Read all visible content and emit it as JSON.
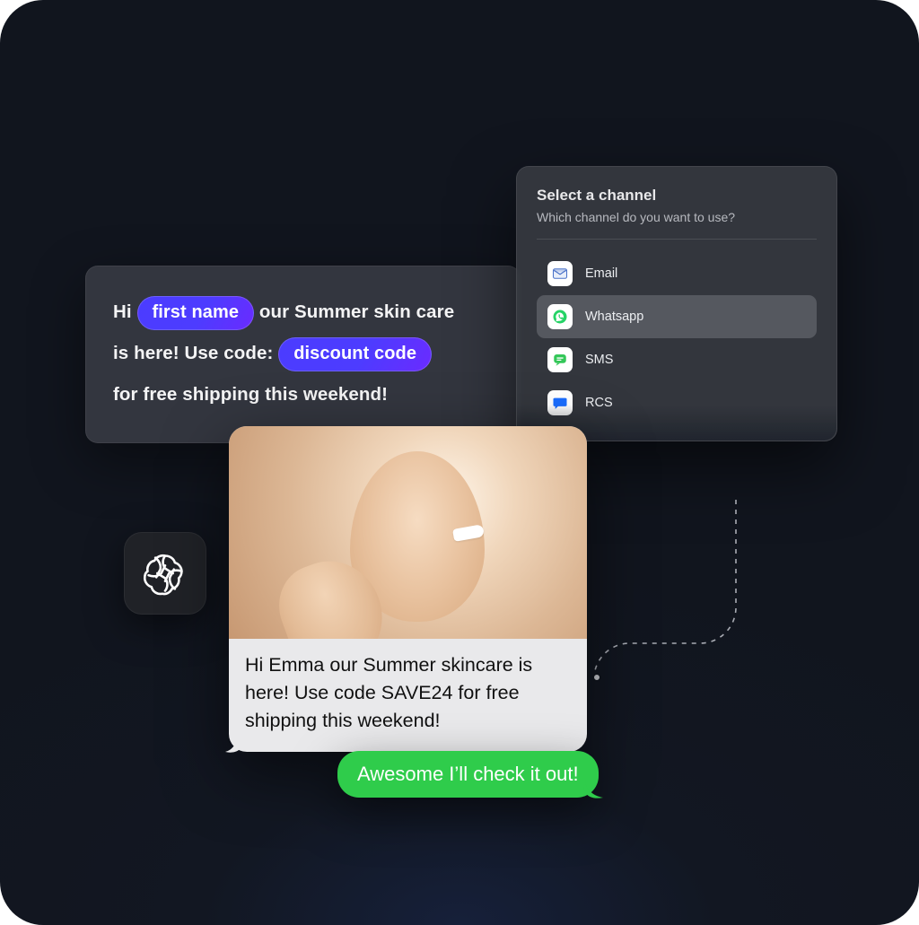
{
  "template": {
    "t1": "Hi",
    "chip_first_name": "first name",
    "t2": "our Summer skin care",
    "t3": "is here! Use code:",
    "chip_discount": "discount code",
    "t4": "for free shipping this weekend!"
  },
  "channel_panel": {
    "title": "Select a channel",
    "subtitle": "Which channel do you want to use?",
    "items": [
      {
        "label": "Email",
        "icon": "email-icon",
        "selected": false
      },
      {
        "label": "Whatsapp",
        "icon": "whatsapp-icon",
        "selected": true
      },
      {
        "label": "SMS",
        "icon": "sms-icon",
        "selected": false
      },
      {
        "label": "RCS",
        "icon": "rcs-icon",
        "selected": false
      }
    ]
  },
  "ai_logo": "openai",
  "delivered_message": "Hi Emma our Summer skincare is here! Use code SAVE24 for free shipping this weekend!",
  "reply_message": "Awesome I’ll check it out!"
}
